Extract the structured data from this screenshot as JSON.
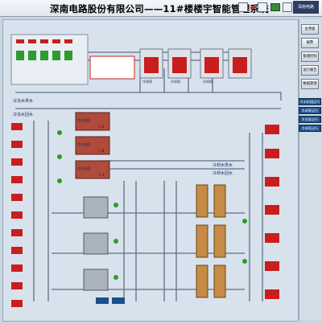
{
  "app": {
    "title": "深南电路股份有限公司——11#楼楼宇智能管理系统",
    "logo_text": "深南电路"
  },
  "menu": [
    {
      "label": "主界面",
      "name": "main"
    },
    {
      "label": "报警",
      "name": "alarm"
    },
    {
      "label": "管理控制",
      "name": "control"
    },
    {
      "label": "运行报告",
      "name": "report"
    },
    {
      "label": "数据管理",
      "name": "data"
    }
  ],
  "status_panel": [
    {
      "label": "冷水机组运行"
    },
    {
      "label": "冷却泵运行"
    },
    {
      "label": "冷冻泵运行"
    },
    {
      "label": "冷却塔运行"
    }
  ],
  "system_labels": {
    "chilled_water_supply": "冷冻水供水",
    "chilled_water_return": "冷冻水回水",
    "cooling_water_supply": "冷却水供水",
    "cooling_water_return": "冷却水回水"
  },
  "chillers": [
    {
      "label": "冷水机组",
      "value": "7.2"
    },
    {
      "label": "冷水机组",
      "value": "7.0"
    },
    {
      "label": "冷水机组",
      "value": "7.1"
    }
  ],
  "towers": [
    {
      "label": "冷却塔"
    },
    {
      "label": "冷却塔"
    },
    {
      "label": "冷却塔"
    }
  ],
  "colors": {
    "pipe": "#5f6f86",
    "pump_red": "#c81e1e",
    "run_green": "#2d9b2d",
    "panel_blue": "#1d4f8c"
  }
}
